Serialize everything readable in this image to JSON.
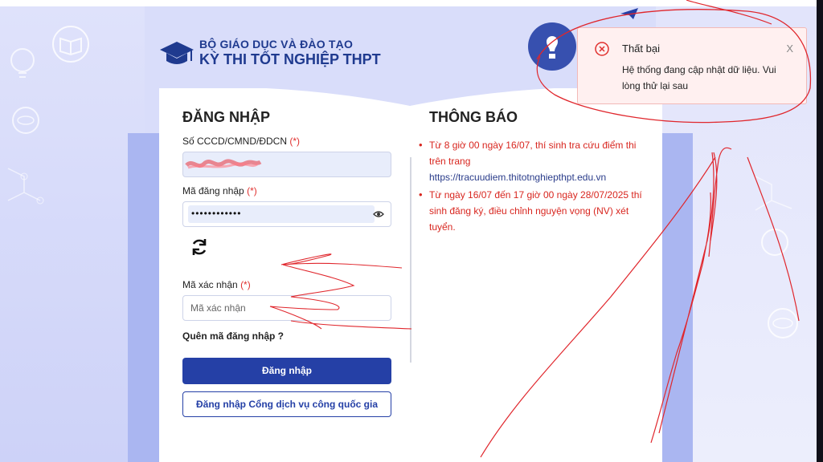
{
  "colors": {
    "brand": "#2540a6",
    "error": "#d8261f",
    "toast_bg": "#fff0f0"
  },
  "header": {
    "logo_icon": "graduation-cap-icon",
    "org": "BỘ GIÁO DỤC VÀ ĐÀO TẠO",
    "title": "KỲ THI TỐT NGHIỆP THPT"
  },
  "login": {
    "heading": "ĐĂNG NHẬP",
    "id_label": "Số CCCD/CMND/ĐDCN",
    "required_mark": "(*)",
    "password_label": "Mã đăng nhập",
    "password_value": "••••••••••••",
    "eye_icon": "eye-icon",
    "refresh_icon": "refresh-icon",
    "captcha_label": "Mã xác nhận",
    "captcha_placeholder": "Mã xác nhận",
    "forgot": "Quên mã đăng nhập ?",
    "submit": "Đăng nhập",
    "national_portal": "Đăng nhập Cổng dịch vụ công quốc gia"
  },
  "notice": {
    "heading": "THÔNG BÁO",
    "items": [
      {
        "text": "Từ 8 giờ 00 ngày 16/07, thí sinh tra cứu điểm thi trên trang",
        "link": "https://tracuudiem.thitotnghiepthpt.edu.vn"
      },
      {
        "text": "Từ ngày 16/07 đến 17 giờ 00 ngày 28/07/2025 thí sinh đăng ký, điều chỉnh nguyện vọng (NV) xét tuyển."
      }
    ]
  },
  "toast": {
    "icon": "error-circle-icon",
    "title": "Thất bại",
    "message": "Hệ thống đang cập nhật dữ liệu. Vui lòng thử lại sau",
    "close": "X"
  }
}
